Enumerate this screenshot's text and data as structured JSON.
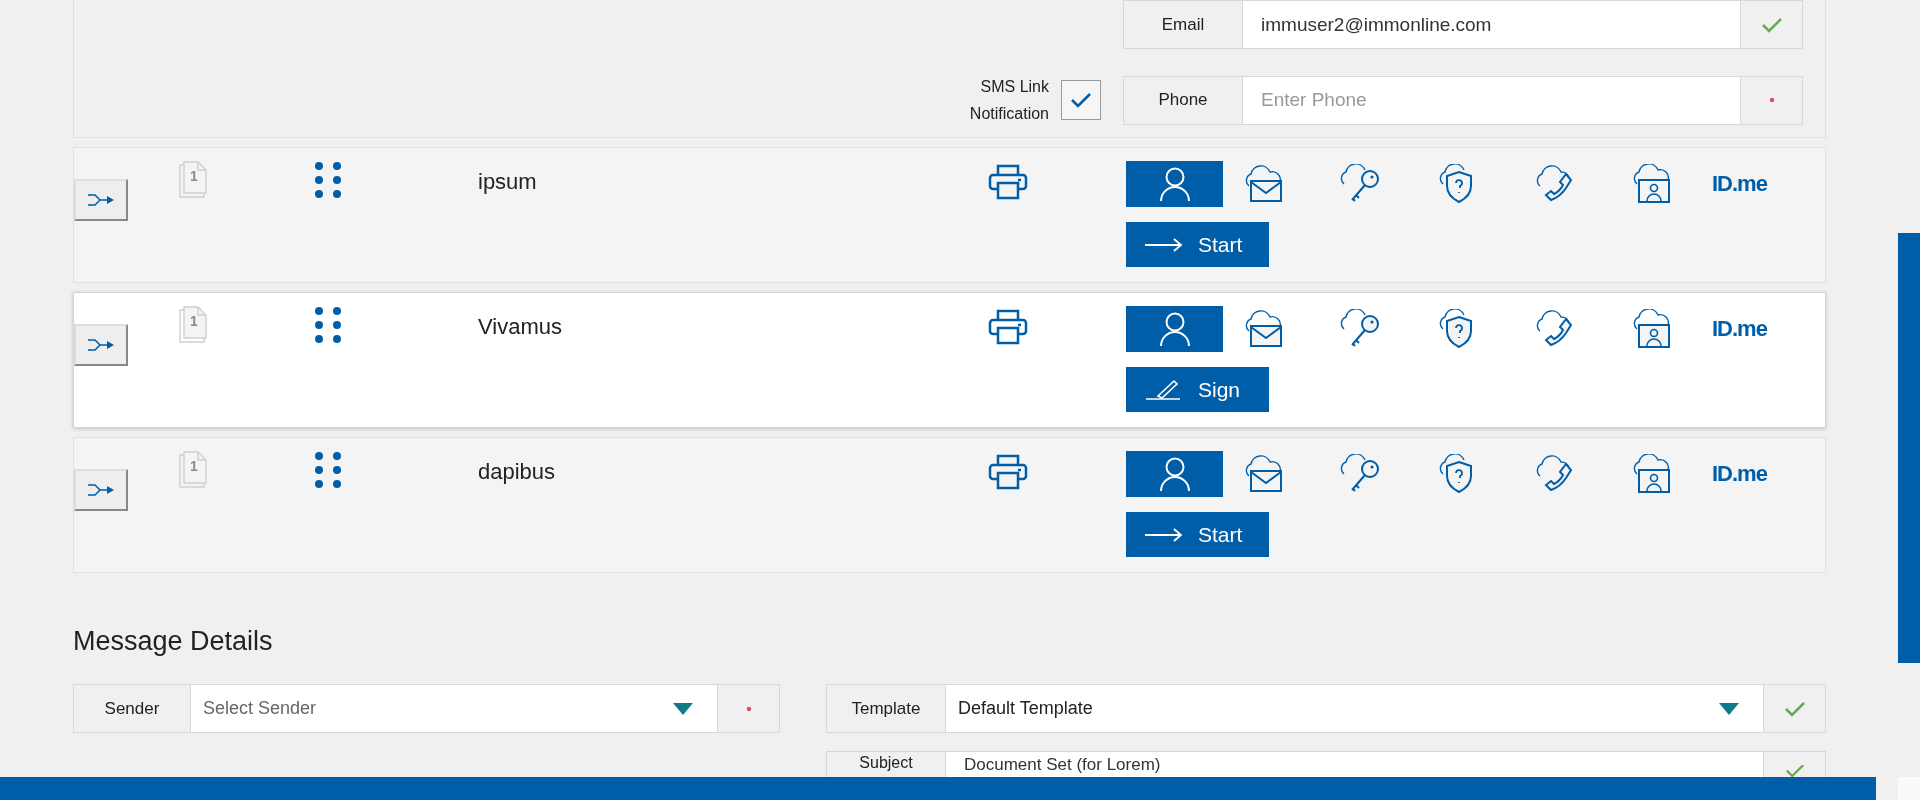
{
  "contact": {
    "email": {
      "label": "Email",
      "value": "immuser2@immonline.com",
      "valid": true
    },
    "sms_notification": {
      "label": "SMS Link Notification",
      "checked": true
    },
    "phone": {
      "label": "Phone",
      "placeholder": "Enter Phone",
      "valid": false
    }
  },
  "recipients": [
    {
      "page_count": "1",
      "name": "ipsum",
      "selected": false,
      "idme_label": "ID.me",
      "action": {
        "kind": "start",
        "label": "Start"
      }
    },
    {
      "page_count": "1",
      "name": "Vivamus",
      "selected": true,
      "idme_label": "ID.me",
      "action": {
        "kind": "sign",
        "label": "Sign"
      }
    },
    {
      "page_count": "1",
      "name": "dapibus",
      "selected": false,
      "idme_label": "ID.me",
      "action": {
        "kind": "start",
        "label": "Start"
      }
    }
  ],
  "message_details": {
    "title": "Message Details",
    "sender": {
      "label": "Sender",
      "placeholder": "Select Sender",
      "valid": false
    },
    "template": {
      "label": "Template",
      "value": "Default Template",
      "valid": true
    },
    "subject": {
      "label": "Subject",
      "value": "Document Set (for Lorem)",
      "valid": true
    }
  }
}
